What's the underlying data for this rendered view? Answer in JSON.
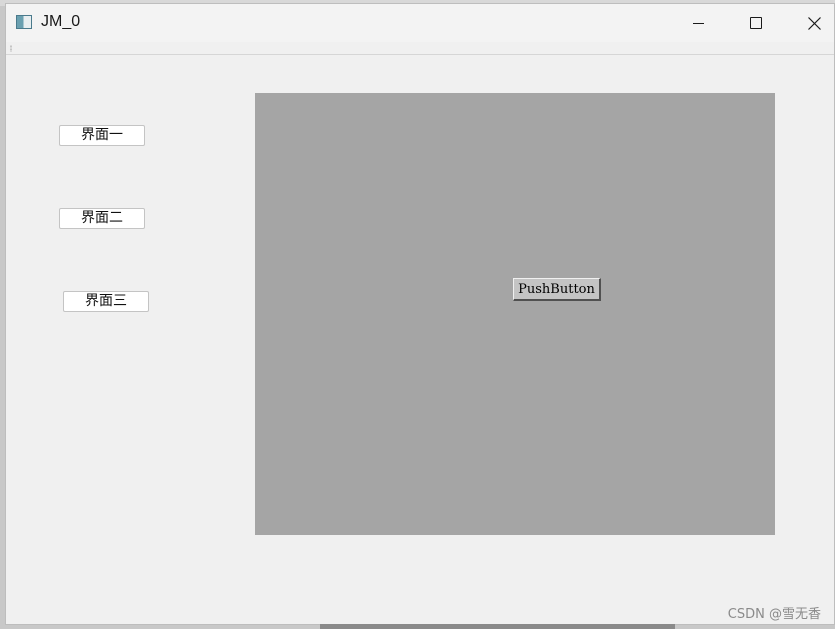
{
  "window": {
    "title": "JM_0"
  },
  "sidebar": {
    "buttons": [
      {
        "label": "界面一"
      },
      {
        "label": "界面二"
      },
      {
        "label": "界面三"
      }
    ]
  },
  "content": {
    "push_button_label": "PushButton"
  },
  "watermark": "CSDN @雪无香",
  "colors": {
    "window_bg": "#f0f0f0",
    "content_panel_bg": "#a5a5a5",
    "push_button_bg": "#c4c4c4"
  },
  "icons": {
    "app": "app-window-icon",
    "minimize": "minimize-icon",
    "maximize": "maximize-icon",
    "close": "close-icon"
  }
}
